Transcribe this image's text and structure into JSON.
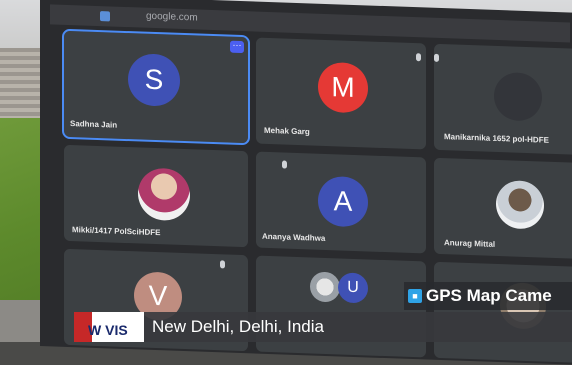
{
  "browser": {
    "url": "google.com"
  },
  "participants": [
    {
      "name": "Sadhna Jain",
      "initial": "S",
      "color": "#3f51b5"
    },
    {
      "name": "Mehak Garg",
      "initial": "M",
      "color": "#e53935"
    },
    {
      "name": "Manikarnika 1652 pol-HDFE",
      "initial": ""
    },
    {
      "name": "Mikki/1417 PolSciHDFE",
      "initial": ""
    },
    {
      "name": "Ananya Wadhwa",
      "initial": "A",
      "color": "#3f51b5"
    },
    {
      "name": "Anurag Mittal",
      "initial": ""
    },
    {
      "name": "",
      "initial": "V",
      "color": "#bf8d80"
    },
    {
      "name": "",
      "initial": "U",
      "color": "#3f51b5"
    }
  ],
  "overlay": {
    "app_name": "GPS Map Came",
    "location": "New Delhi, Delhi, India",
    "logo_text": "W VIS"
  },
  "icons": {
    "more": "more-options-icon",
    "mic": "mic-off-icon",
    "gps": "gps-camera-icon"
  }
}
